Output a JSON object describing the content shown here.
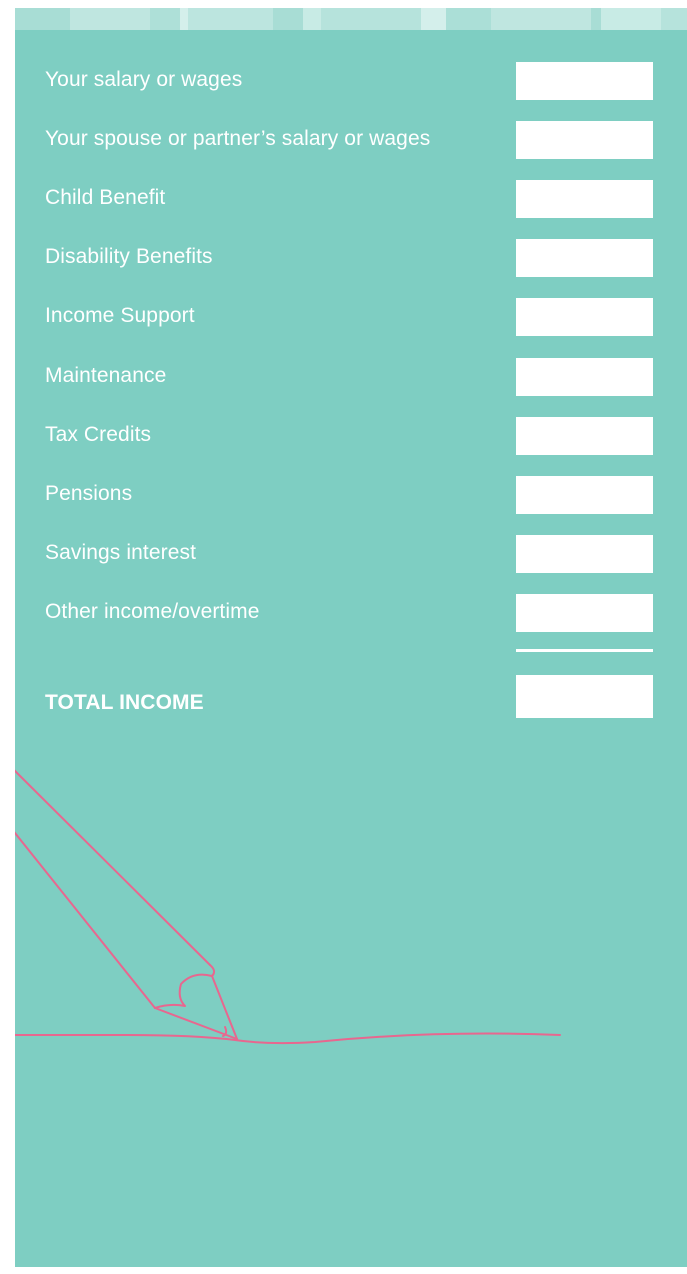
{
  "income_items": [
    {
      "label": "Your salary or wages",
      "value": ""
    },
    {
      "label": "Your spouse or partner’s salary or wages",
      "value": ""
    },
    {
      "label": "Child Benefit",
      "value": ""
    },
    {
      "label": "Disability Benefits",
      "value": ""
    },
    {
      "label": "Income Support",
      "value": ""
    },
    {
      "label": "Maintenance",
      "value": ""
    },
    {
      "label": "Tax Credits",
      "value": ""
    },
    {
      "label": "Pensions",
      "value": ""
    },
    {
      "label": "Savings interest",
      "value": ""
    },
    {
      "label": "Other income/overtime",
      "value": ""
    }
  ],
  "total": {
    "label": "TOTAL INCOME",
    "value": ""
  },
  "colors": {
    "panel_background": "#7ecec2",
    "field_background": "#ffffff",
    "pencil_stroke": "#e8678f",
    "stripe_light": "#c4e8e2"
  },
  "icons": {
    "decoration": "pencil-drawing-icon"
  }
}
